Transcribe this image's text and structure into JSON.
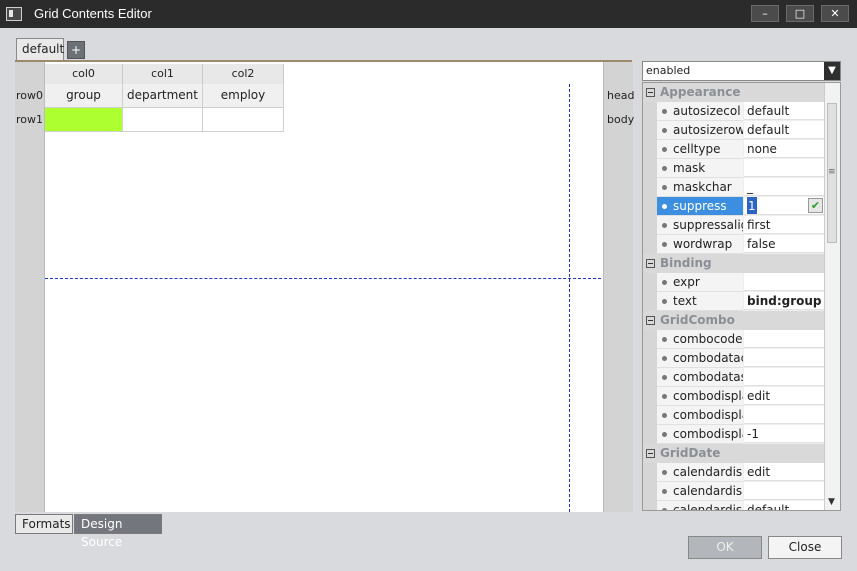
{
  "window": {
    "title": "Grid Contents Editor"
  },
  "titlebar": {
    "minimize": "–",
    "restore": "□",
    "close": "✕"
  },
  "tabs": {
    "format": "default",
    "add": "+"
  },
  "grid": {
    "columns": [
      "col0",
      "col1",
      "col2"
    ],
    "row_labels": [
      "row0",
      "row1"
    ],
    "head_cells": [
      "group",
      "department",
      "employ"
    ],
    "band_labels": [
      "head",
      "body"
    ],
    "selected_cell_color": "#adff2f"
  },
  "bottom_tabs": [
    "Formats",
    "Design Source"
  ],
  "properties": {
    "selector_value": "enabled",
    "categories": {
      "appearance": "Appearance",
      "binding": "Binding",
      "gridcombo": "GridCombo",
      "griddate": "GridDate"
    },
    "appearance": [
      {
        "name": "autosizecol",
        "value": "default"
      },
      {
        "name": "autosizerow",
        "value": "default"
      },
      {
        "name": "celltype",
        "value": "none"
      },
      {
        "name": "mask",
        "value": ""
      },
      {
        "name": "maskchar",
        "value": "_"
      },
      {
        "name": "suppress",
        "value": "1"
      },
      {
        "name": "suppressalign",
        "value": "first"
      },
      {
        "name": "wordwrap",
        "value": "false"
      }
    ],
    "binding": [
      {
        "name": "expr",
        "value": ""
      },
      {
        "name": "text",
        "value": "bind:group"
      }
    ],
    "gridcombo": [
      {
        "name": "combocodecol",
        "value": ""
      },
      {
        "name": "combodatacol",
        "value": ""
      },
      {
        "name": "combodataset",
        "value": ""
      },
      {
        "name": "combodisplay",
        "value": "edit"
      },
      {
        "name": "combodisplaynulltext",
        "value": ""
      },
      {
        "name": "combodisplayrowcount",
        "value": "-1"
      }
    ],
    "griddate": [
      {
        "name": "calendardisplay",
        "value": "edit"
      },
      {
        "name": "calendardisplaynulltext",
        "value": ""
      },
      {
        "name": "calendardisplaytype",
        "value": "default"
      }
    ]
  },
  "buttons": {
    "ok": "OK",
    "close": "Close"
  }
}
